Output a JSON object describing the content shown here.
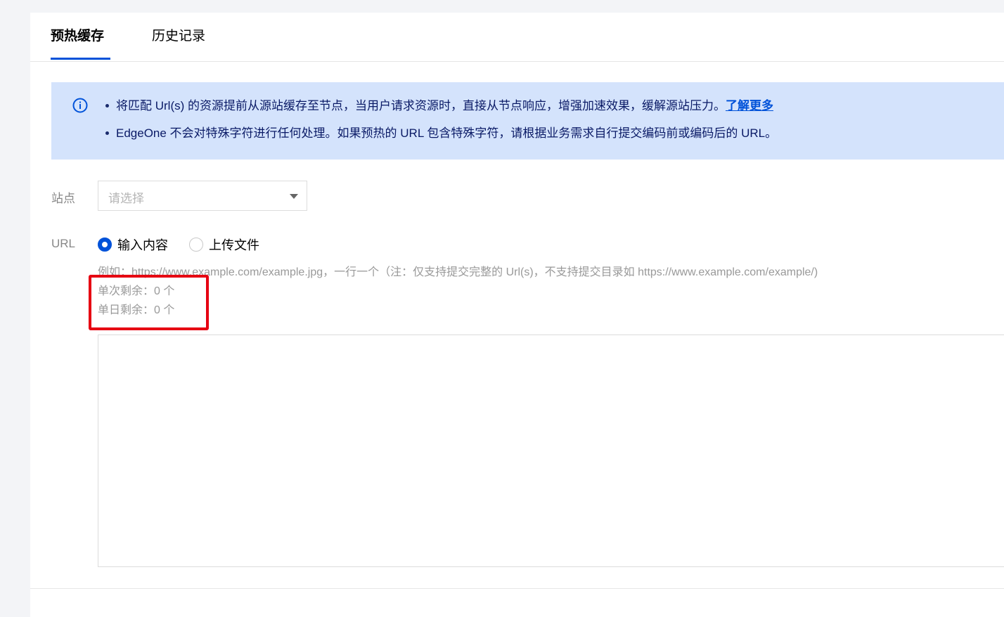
{
  "tabs": [
    {
      "label": "预热缓存",
      "active": true
    },
    {
      "label": "历史记录",
      "active": false
    }
  ],
  "notice": {
    "icon": "info-icon",
    "line1": "将匹配 Url(s) 的资源提前从源站缓存至节点，当用户请求资源时，直接从节点响应，增强加速效果，缓解源站压力。",
    "link": "了解更多",
    "line2": "EdgeOne 不会对特殊字符进行任何处理。如果预热的 URL 包含特殊字符，请根据业务需求自行提交编码前或编码后的 URL。"
  },
  "form": {
    "site_label": "站点",
    "site_placeholder": "请选择",
    "url_label": "URL",
    "radio_input_label": "输入内容",
    "radio_upload_label": "上传文件",
    "selected_mode": "输入内容",
    "example_hint": "例如：https://www.example.com/example.jpg，一行一个（注：仅支持提交完整的 Url(s)，不支持提交目录如 https://www.example.com/example/)",
    "single_remaining": "单次剩余：0 个",
    "daily_remaining": "单日剩余：0 个",
    "textarea_value": ""
  },
  "colors": {
    "accent": "#0052d9",
    "notice_bg": "#d4e3fc",
    "highlight": "#e60012"
  }
}
